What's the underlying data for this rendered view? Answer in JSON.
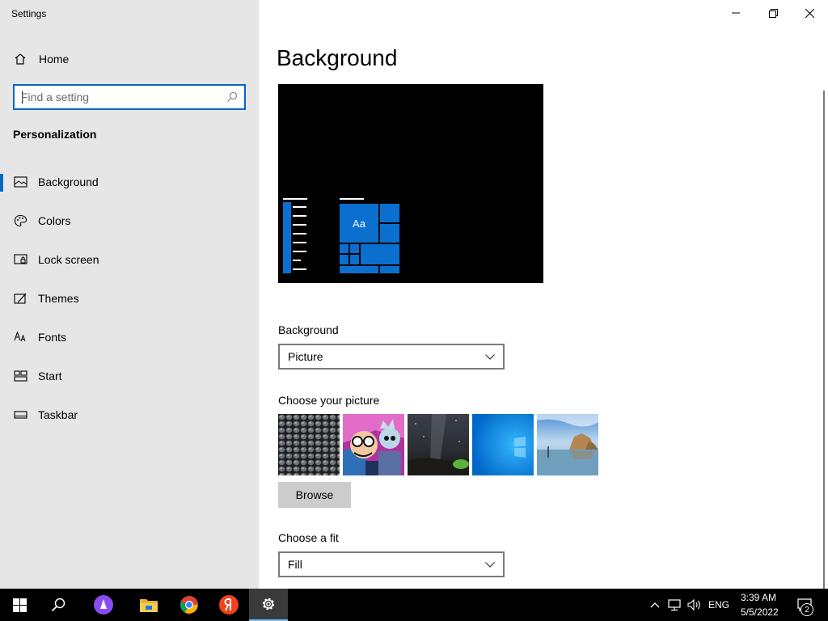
{
  "window": {
    "title": "Settings"
  },
  "sidebar": {
    "home_label": "Home",
    "search_placeholder": "Find a setting",
    "section_title": "Personalization",
    "items": [
      {
        "label": "Background",
        "icon": "picture-icon",
        "active": true
      },
      {
        "label": "Colors",
        "icon": "palette-icon"
      },
      {
        "label": "Lock screen",
        "icon": "lock-screen-icon"
      },
      {
        "label": "Themes",
        "icon": "themes-icon"
      },
      {
        "label": "Fonts",
        "icon": "fonts-icon"
      },
      {
        "label": "Start",
        "icon": "start-icon"
      },
      {
        "label": "Taskbar",
        "icon": "taskbar-icon"
      }
    ]
  },
  "main": {
    "title": "Background",
    "preview_sample_text": "Aa",
    "background_label": "Background",
    "background_value": "Picture",
    "choose_picture_label": "Choose your picture",
    "browse_label": "Browse",
    "fit_label": "Choose a fit",
    "fit_value": "Fill"
  },
  "taskbar": {
    "language": "ENG",
    "time": "3:39 AM",
    "date": "5/5/2022",
    "notification_count": "2"
  },
  "colors": {
    "accent": "#0067c0",
    "sidebar_bg": "#e6e6e6",
    "taskbar_bg": "#000000",
    "tile_blue": "#0a6fcf"
  }
}
